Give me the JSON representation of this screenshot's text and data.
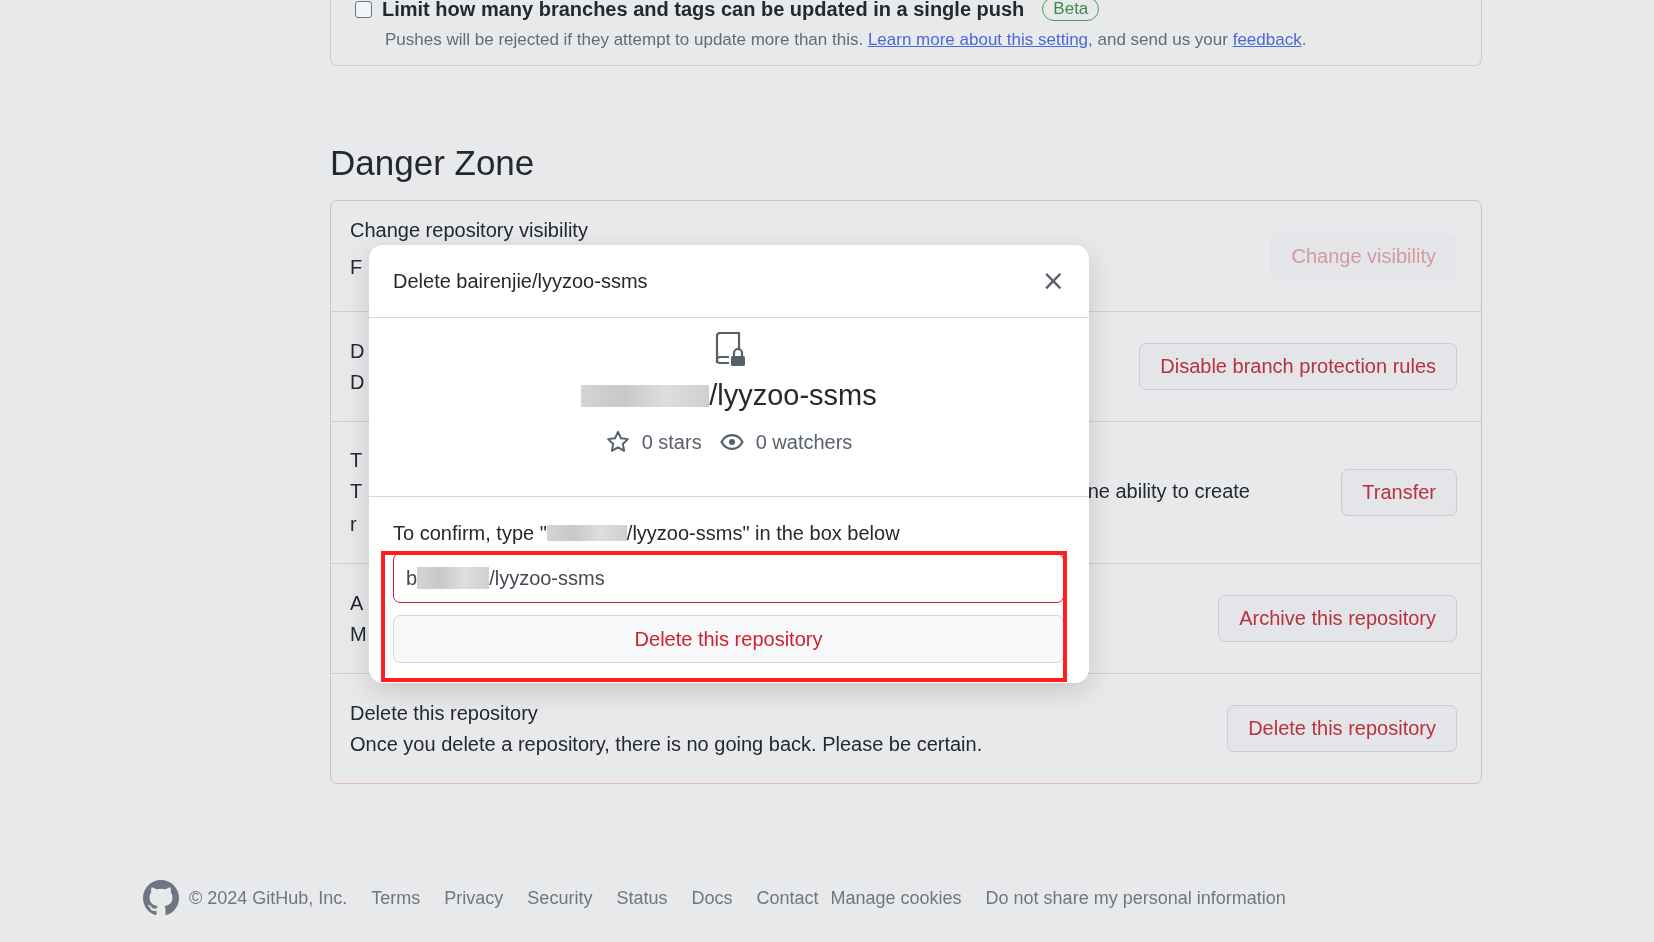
{
  "push_limit": {
    "checked": false,
    "label": "Limit how many branches and tags can be updated in a single push",
    "badge": "Beta",
    "note_parts": [
      "Pushes will be rejected if they attempt to update more than this. ",
      ", and send us your ",
      "."
    ],
    "links": [
      "Learn more about this setting",
      "feedback"
    ]
  },
  "danger_zone": {
    "heading": "Danger Zone",
    "rows": [
      {
        "title": "Change repository visibility",
        "desc": "F",
        "tail": "",
        "button": "Change visibility",
        "disabled": true
      },
      {
        "title": "D",
        "desc": "D",
        "tail": "",
        "button": "Disable branch protection rules",
        "disabled": false
      },
      {
        "title": "T",
        "desc": "T",
        "tail": "ne ability to create",
        "extra": "r",
        "button": "Transfer",
        "disabled": false
      },
      {
        "title": "A",
        "desc": "M",
        "tail": "",
        "button": "Archive this repository",
        "disabled": false
      },
      {
        "title": "Delete this repository",
        "desc": "Once you delete a repository, there is no going back. Please be certain.",
        "tail": "",
        "button": "Delete this repository",
        "disabled": false
      }
    ]
  },
  "dialog": {
    "title": "Delete bairenjie/lyyzoo-ssms",
    "close": "×",
    "repo_name": "/lyyzoo-ssms",
    "stars": "0 stars",
    "watchers": "0 watchers",
    "confirm_before": "To confirm, type \"",
    "confirm_after": "/lyyzoo-ssms\" in the box below",
    "field_first": "b",
    "field_rest": "/lyyzoo-ssms",
    "button": "Delete this repository"
  },
  "footer": {
    "copyright": "© 2024 GitHub, Inc.",
    "links": [
      "Terms",
      "Privacy",
      "Security",
      "Status",
      "Docs",
      "Contact",
      "Manage cookies",
      "Do not share my personal information"
    ]
  }
}
